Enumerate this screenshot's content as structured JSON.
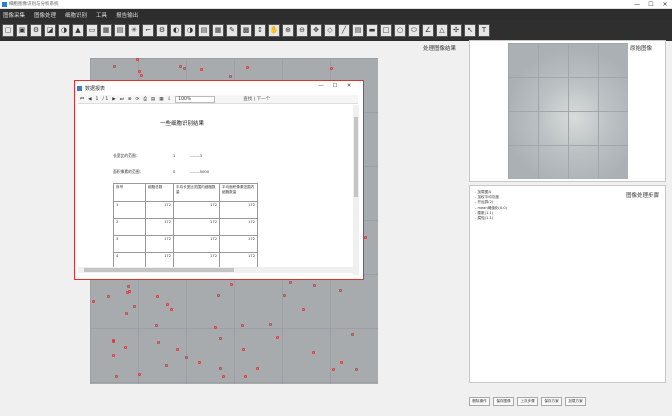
{
  "window": {
    "title": "细胞图像识别与分析系统",
    "controls": [
      "—",
      "☐",
      "✕"
    ]
  },
  "menu": [
    "图像采集",
    "图像处理",
    "细胞识别",
    "工具",
    "报告输出"
  ],
  "toolbar_icons": [
    "open-icon",
    "save-icon",
    "tool-icon",
    "gray-icon",
    "contrast-icon",
    "triangle-icon",
    "frame-icon",
    "image-icon",
    "histogram-icon",
    "cell-icon",
    "bone-icon",
    "gear-icon",
    "invert-icon",
    "brightness-icon",
    "doc-icon",
    "table-icon",
    "edit-icon",
    "layers-icon",
    "measure-icon",
    "hand-icon",
    "zoom-in-icon",
    "zoom-out-icon",
    "pan-icon",
    "shape-icon",
    "line-icon",
    "text-block-icon",
    "ruler-icon",
    "rect-icon",
    "circle-icon",
    "ellipse-icon",
    "angle-icon",
    "triangle-measure-icon",
    "move-icon",
    "arrow-icon",
    "text-icon"
  ],
  "toolbar_glyphs": [
    "▢",
    "▣",
    "⚙",
    "◪",
    "◑",
    "▲",
    "▭",
    "▦",
    "▤",
    "✳",
    "⌐",
    "⚙",
    "◐",
    "◑",
    "▤",
    "▦",
    "✎",
    "▩",
    "↕",
    "✋",
    "⊕",
    "⊖",
    "✥",
    "◇",
    "╱",
    "▤",
    "▬",
    "□",
    "○",
    "⬭",
    "∠",
    "△",
    "✣",
    "↖",
    "T"
  ],
  "processed_label": "处理图像结果",
  "original_label": "原始图像",
  "steps": {
    "title": "图像处理步骤",
    "items": [
      "- 加载图片",
      "- 加权平均灰度",
      "- 开运算(2)",
      "- mean阈值化(0-0)",
      "- 膨胀(1.1)",
      "- 腐蚀(1.1)"
    ]
  },
  "bottom_buttons": [
    "删除操作",
    "保存图像",
    "上次步骤",
    "保存方案",
    "加载方案"
  ],
  "dialog": {
    "title": "数据报表",
    "controls": [
      "—",
      "☐",
      "✕"
    ],
    "viewer": {
      "page": "1",
      "page_sep": "/ 1",
      "zoom": "100%",
      "search": "查找 | 下一个"
    },
    "report": {
      "title": "一些细胞识别结果",
      "area_label": "长宽比的范围：",
      "area_min": "1",
      "area_max": "-------3",
      "pixel_label": "面积像素的范围：",
      "pixel_min": "0",
      "pixel_max": "-------5000",
      "headers": [
        "序号",
        "细胞总数",
        "平均长宽比范围内细胞数量",
        "平均面积像素范围内细胞数量"
      ],
      "rows": [
        [
          "1",
          "172",
          "172",
          "172"
        ],
        [
          "2",
          "172",
          "172",
          "172"
        ],
        [
          "3",
          "172",
          "172",
          "172"
        ],
        [
          "4",
          "172",
          "172",
          "172"
        ]
      ]
    }
  }
}
